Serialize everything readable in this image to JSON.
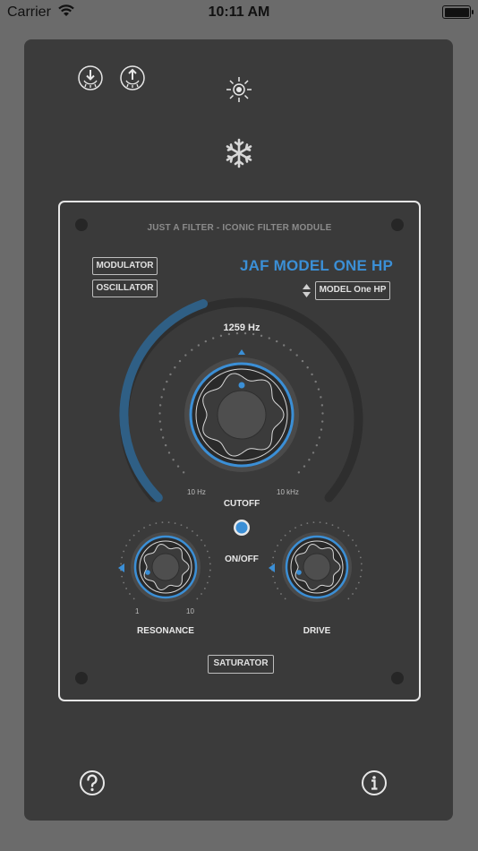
{
  "status_bar": {
    "carrier": "Carrier",
    "time": "10:11 AM"
  },
  "toolbar": {
    "icons": [
      "download-icon",
      "upload-icon",
      "brightness-icon",
      "snowflake-icon"
    ]
  },
  "module": {
    "title": "JUST A FILTER - ICONIC FILTER MODULE",
    "model_title": "JAF MODEL ONE HP",
    "modulator_label": "MODULATOR",
    "oscillator_label": "OSCILLATOR",
    "model_select": "MODEL One HP",
    "cutoff": {
      "readout": "1259 Hz",
      "label": "CUTOFF",
      "min_label": "10 Hz",
      "max_label": "10 kHz",
      "level": 0.43
    },
    "onoff_label": "ON/OFF",
    "resonance": {
      "label": "RESONANCE",
      "min_label": "1",
      "max_label": "10",
      "level": 0.0
    },
    "drive": {
      "label": "DRIVE",
      "level": 0.0
    },
    "saturator_label": "SATURATOR"
  },
  "bottom": {
    "icons": [
      "help-icon",
      "info-icon"
    ]
  },
  "colors": {
    "accent": "#3b8fd6",
    "panel": "#3a3a3a",
    "background": "#6b6b6b",
    "device": "#3b3b3b"
  }
}
